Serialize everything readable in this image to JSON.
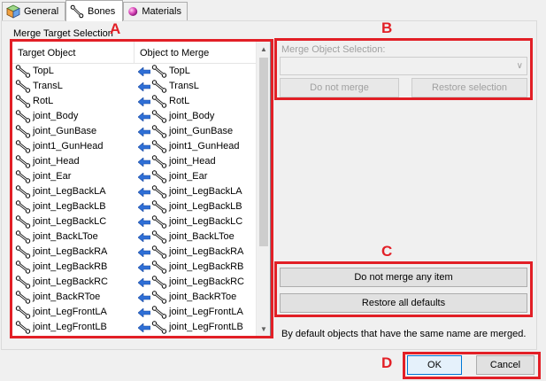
{
  "tabs": [
    {
      "label": "General",
      "icon": "cube-icon"
    },
    {
      "label": "Bones",
      "icon": "bone-icon"
    },
    {
      "label": "Materials",
      "icon": "sphere-icon"
    }
  ],
  "merge_target_label": "Merge Target Selection",
  "list": {
    "headers": [
      "Target Object",
      "Object to Merge"
    ],
    "rows": [
      [
        "TopL",
        "TopL"
      ],
      [
        "TransL",
        "TransL"
      ],
      [
        "RotL",
        "RotL"
      ],
      [
        "joint_Body",
        "joint_Body"
      ],
      [
        "joint_GunBase",
        "joint_GunBase"
      ],
      [
        "joint1_GunHead",
        "joint1_GunHead"
      ],
      [
        "joint_Head",
        "joint_Head"
      ],
      [
        "joint_Ear",
        "joint_Ear"
      ],
      [
        "joint_LegBackLA",
        "joint_LegBackLA"
      ],
      [
        "joint_LegBackLB",
        "joint_LegBackLB"
      ],
      [
        "joint_LegBackLC",
        "joint_LegBackLC"
      ],
      [
        "joint_BackLToe",
        "joint_BackLToe"
      ],
      [
        "joint_LegBackRA",
        "joint_LegBackRA"
      ],
      [
        "joint_LegBackRB",
        "joint_LegBackRB"
      ],
      [
        "joint_LegBackRC",
        "joint_LegBackRC"
      ],
      [
        "joint_BackRToe",
        "joint_BackRToe"
      ],
      [
        "joint_LegFrontLA",
        "joint_LegFrontLA"
      ],
      [
        "joint_LegFrontLB",
        "joint_LegFrontLB"
      ]
    ]
  },
  "merge_object": {
    "label": "Merge Object Selection:",
    "combo_value": "",
    "do_not_merge": "Do not merge",
    "restore_selection": "Restore selection"
  },
  "global": {
    "do_not_merge_any": "Do not merge any item",
    "restore_all_defaults": "Restore all defaults",
    "note": "By default objects that have the same name are merged."
  },
  "dialog": {
    "ok": "OK",
    "cancel": "Cancel"
  },
  "annotations": {
    "a": "A",
    "b": "B",
    "c": "C",
    "d": "D"
  },
  "colors": {
    "annotation": "#e21f26",
    "arrow": "#2f6fd6"
  }
}
